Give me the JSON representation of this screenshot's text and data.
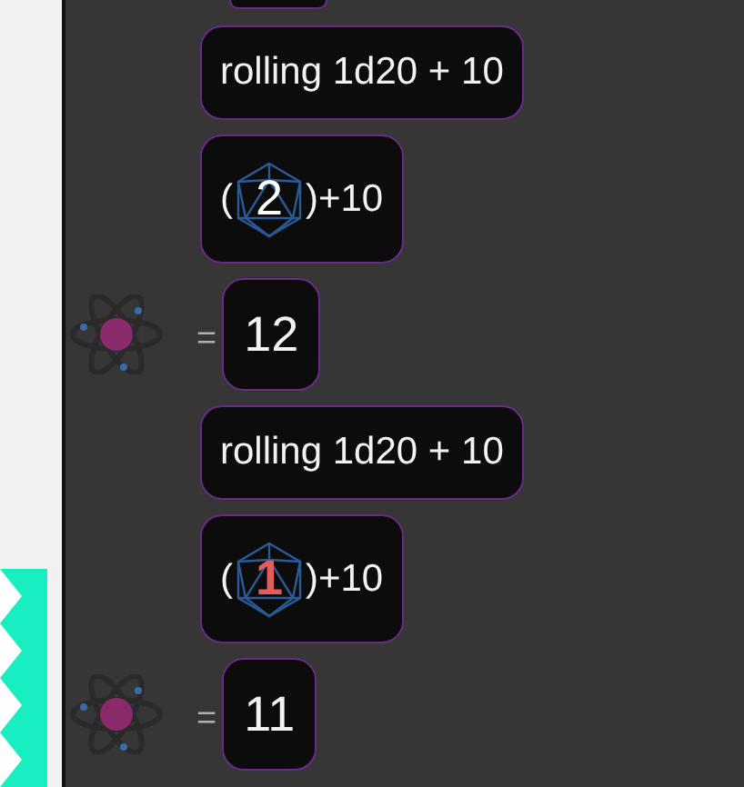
{
  "messages": [
    {
      "kind": "text",
      "text": "rolling 1d20 + 10"
    },
    {
      "kind": "roll",
      "prefix": "(",
      "die": "2",
      "critical_fail": false,
      "suffix": ")+10"
    },
    {
      "kind": "result",
      "equals": "=",
      "total": "12"
    },
    {
      "kind": "text",
      "text": "rolling 1d20 + 10"
    },
    {
      "kind": "roll",
      "prefix": "(",
      "die": "1",
      "critical_fail": true,
      "suffix": ")+10"
    },
    {
      "kind": "result",
      "equals": "=",
      "total": "11"
    }
  ]
}
